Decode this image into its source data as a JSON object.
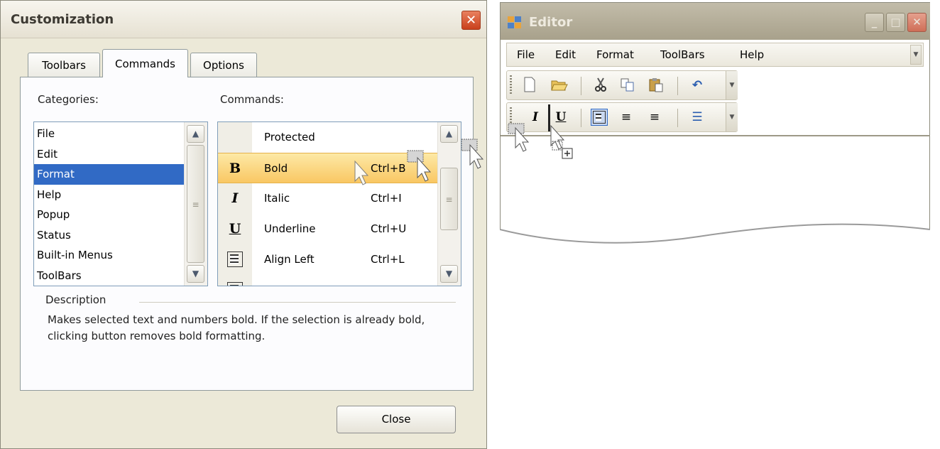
{
  "dialog": {
    "title": "Customization",
    "close_glyph": "✕",
    "tabs": [
      {
        "label": "Toolbars",
        "active": false
      },
      {
        "label": "Commands",
        "active": true
      },
      {
        "label": "Options",
        "active": false
      }
    ],
    "categories_label": "Categories:",
    "commands_label": "Commands:",
    "categories": [
      "File",
      "Edit",
      "Format",
      "Help",
      "Popup",
      "Status",
      "Built-in Menus",
      "ToolBars"
    ],
    "selected_category": "Format",
    "commands": [
      {
        "name": "Protected",
        "shortcut": "",
        "icon": "none"
      },
      {
        "name": "Bold",
        "shortcut": "Ctrl+B",
        "icon": "bold-icon",
        "glyph": "B",
        "selected": true
      },
      {
        "name": "Italic",
        "shortcut": "Ctrl+I",
        "icon": "italic-icon",
        "glyph": "I"
      },
      {
        "name": "Underline",
        "shortcut": "Ctrl+U",
        "icon": "underline-icon",
        "glyph": "U"
      },
      {
        "name": "Align Left",
        "shortcut": "Ctrl+L",
        "icon": "align-left-icon"
      }
    ],
    "description_label": "Description",
    "description_text": "Makes selected text and numbers bold. If the selection is already bold, clicking button removes bold formatting.",
    "close_button": "Close"
  },
  "editor": {
    "title": "Editor",
    "window_buttons": [
      "_",
      "□",
      "✕"
    ],
    "menu": [
      "File",
      "Edit",
      "Format",
      "ToolBars",
      "Help"
    ],
    "toolbar1": [
      "new-icon",
      "open-icon",
      "cut-icon",
      "copy-icon",
      "paste-icon",
      "undo-icon"
    ],
    "toolbar2": [
      "italic-icon",
      "underline-icon",
      "align-left-icon",
      "align-center-icon",
      "align-right-icon",
      "bullets-icon"
    ],
    "toolbar2_glyphs": {
      "italic": "I",
      "underline": "U",
      "center": "≡",
      "right": "≡",
      "bullets": "☰"
    }
  },
  "colors": {
    "selection_blue": "#316ac5",
    "highlight_orange": "#f9c763",
    "dialog_bg": "#ece9d8",
    "close_red": "#c9401c"
  }
}
